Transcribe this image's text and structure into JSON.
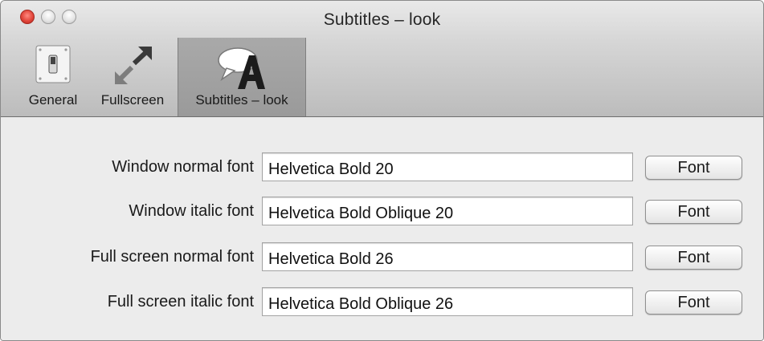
{
  "window": {
    "title": "Subtitles – look"
  },
  "toolbar": {
    "items": [
      {
        "label": "General",
        "icon": "switch-icon",
        "selected": false
      },
      {
        "label": "Fullscreen",
        "icon": "expand-arrows-icon",
        "selected": false
      },
      {
        "label": "Subtitles – look",
        "icon": "speech-bubble-font-icon",
        "selected": true
      }
    ]
  },
  "fonts": [
    {
      "label": "Window normal font",
      "value": "Helvetica Bold 20",
      "button": "Font"
    },
    {
      "label": "Window italic font",
      "value": "Helvetica Bold Oblique 20",
      "button": "Font"
    },
    {
      "label": "Full screen normal font",
      "value": "Helvetica Bold 26",
      "button": "Font"
    },
    {
      "label": "Full screen italic font",
      "value": "Helvetica Bold Oblique 26",
      "button": "Font"
    }
  ]
}
